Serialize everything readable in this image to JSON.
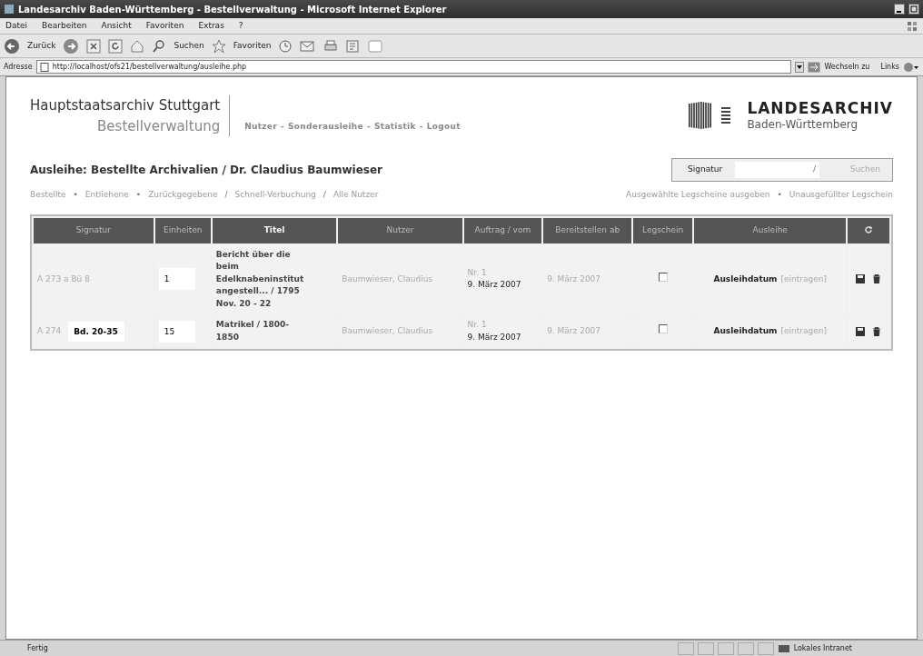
{
  "window": {
    "title": "Landesarchiv Baden-Württemberg - Bestellverwaltung - Microsoft Internet Explorer"
  },
  "menu": [
    "Datei",
    "Bearbeiten",
    "Ansicht",
    "Favoriten",
    "Extras",
    "?"
  ],
  "toolbar": {
    "back": "Zurück",
    "search": "Suchen",
    "favorites": "Favoriten"
  },
  "address_bar": {
    "label": "Adresse",
    "url": "http://localhost/ofs21/bestellverwaltung/ausleihe.php",
    "go": "Wechseln zu",
    "links": "Links"
  },
  "header": {
    "org": "Hauptstaatsarchiv Stuttgart",
    "app": "Bestellverwaltung",
    "nav": [
      "Nutzer",
      "Sonderausleihe",
      "Statistik",
      "Logout"
    ],
    "nav_separator": "-",
    "logo_title": "LANDESARCHIV",
    "logo_subtitle": "Baden-Württemberg"
  },
  "search": {
    "label": "Signatur",
    "divider": "/",
    "button": "Suchen"
  },
  "heading": "Ausleihe: Bestellte Archivalien / Dr. Claudius Baumwieser",
  "subnav": [
    {
      "label": "Bestellte",
      "separator": "•"
    },
    {
      "label": "Entliehene",
      "separator": "•"
    },
    {
      "label": "Zurückgegebene",
      "separator": "/"
    },
    {
      "label": "Schnell-Verbuchung",
      "separator": "/"
    },
    {
      "label": "Alle Nutzer"
    }
  ],
  "actions": [
    {
      "label": "Ausgewählte Legscheine ausgeben",
      "separator": "•"
    },
    {
      "label": "Unausgefüllter Legschein"
    }
  ],
  "table": {
    "columns": [
      {
        "label": "Signatur",
        "selected": false
      },
      {
        "label": "Einheiten",
        "selected": false
      },
      {
        "label": "Titel",
        "selected": true
      },
      {
        "label": "Nutzer",
        "selected": false
      },
      {
        "label": "Auftrag / vom",
        "selected": false
      },
      {
        "label": "Bereitstellen ab",
        "selected": false
      },
      {
        "label": "Legschein",
        "selected": false
      },
      {
        "label": "Ausleihe",
        "selected": false
      }
    ],
    "rows": [
      {
        "signatur": "A 273 a Bü 8",
        "einheiten": "1",
        "titel": "Bericht über die beim Edelknabeninstitut angestell... / 1795 Nov. 20 - 22",
        "nutzer": "Baumwieser, Claudius",
        "auftrag_nr": "Nr. 1",
        "auftrag_date": "9. März 2007",
        "bereitstellen": "9. März 2007",
        "legschein": false,
        "ausleihe_label": "Ausleihdatum",
        "ausleihe_link": "[eintragen]"
      },
      {
        "signatur": "A 274",
        "band": "Bd. 20-35",
        "einheiten": "15",
        "titel": "Matrikel / 1800-1850",
        "nutzer": "Baumwieser, Claudius",
        "auftrag_nr": "Nr. 1",
        "auftrag_date": "9. März 2007",
        "bereitstellen": "9. März 2007",
        "legschein": false,
        "ausleihe_label": "Ausleihdatum",
        "ausleihe_link": "[eintragen]"
      }
    ]
  },
  "status_bar": {
    "text": "Fertig",
    "zone": "Lokales Intranet"
  }
}
